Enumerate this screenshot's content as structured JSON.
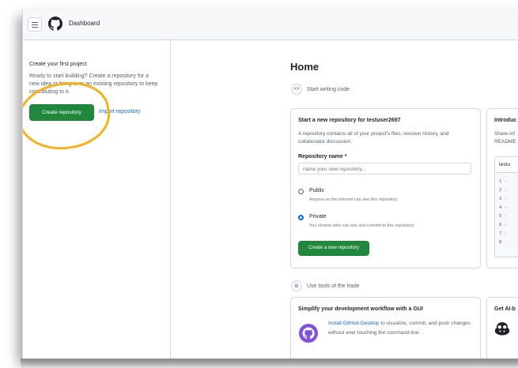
{
  "topbar": {
    "title": "Dashboard"
  },
  "sidebar": {
    "title": "Create your first project",
    "description": "Ready to start building? Create a repository for a new idea or bring over an existing repository to keep contributing to it.",
    "create_label": "Create repository",
    "import_label": "Import repository"
  },
  "main": {
    "title": "Home",
    "section_writing": "Start writing code",
    "section_tools": "Use tools of the trade"
  },
  "new_repo": {
    "title": "Start a new repository for testuser2697",
    "description": "A repository contains all of your project's files, revision history, and collaborator discussion.",
    "name_label": "Repository name *",
    "name_placeholder": "name your new repository...",
    "public_label": "Public",
    "public_desc": "Anyone on the internet can see this repository",
    "private_label": "Private",
    "private_desc": "You choose who can see and commit to this repository",
    "selected_visibility": "Private",
    "create_label": "Create a new repository"
  },
  "intro": {
    "title": "Introduc",
    "desc_line1": "Share inf",
    "desc_line2": "README",
    "code_header": "testu",
    "lines": [
      "1 -",
      "2 -",
      "3 -",
      "4 -",
      "5 -",
      "6 -",
      "7 -",
      "8"
    ]
  },
  "gui": {
    "title": "Simplify your development workflow with a GUI",
    "link": "Install GitHub Desktop",
    "text": " to visualize, commit, and push changes without ever touching the command line."
  },
  "ai": {
    "title": "Get AI-b"
  },
  "colors": {
    "accent_green": "#1f883d",
    "link_blue": "#0969da",
    "annotation": "#f6b11c"
  }
}
